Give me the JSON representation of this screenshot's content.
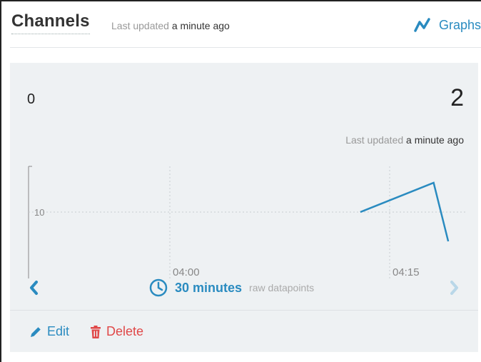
{
  "header": {
    "title": "Channels",
    "updated_prefix": "Last updated",
    "updated_value": "a minute ago",
    "graphs_label": "Graphs"
  },
  "channel": {
    "value_left": "0",
    "value_right": "2",
    "updated_prefix": "Last updated",
    "updated_value": "a minute ago"
  },
  "range": {
    "value": "30 minutes",
    "description": "raw datapoints"
  },
  "actions": {
    "edit_label": "Edit",
    "delete_label": "Delete"
  },
  "colors": {
    "accent": "#2a8bc0",
    "danger": "#e04848",
    "card_bg": "#eef1f3"
  },
  "icons": [
    "graph-icon",
    "chevron-left-icon",
    "clock-icon",
    "chevron-right-icon",
    "pencil-icon",
    "trash-icon"
  ],
  "chart_data": {
    "type": "line",
    "x_ticks": [
      "04:00",
      "04:15"
    ],
    "y_ticks": [
      10
    ],
    "series": [
      {
        "x": [
          "04:13",
          "04:18",
          "04:19"
        ],
        "values": [
          10,
          12,
          8
        ]
      }
    ]
  }
}
